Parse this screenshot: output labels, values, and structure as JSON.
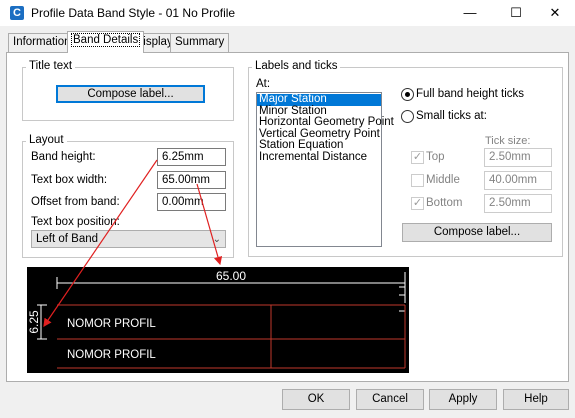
{
  "window": {
    "title": "Profile Data Band Style - 01 No Profile",
    "app_icon_letter": "C",
    "minimize": "—",
    "maximize": "☐",
    "close": "✕"
  },
  "tabs": [
    {
      "label": "Information"
    },
    {
      "label": "Band Details"
    },
    {
      "label": "Display"
    },
    {
      "label": "Summary"
    }
  ],
  "title_text": {
    "group_label": "Title text",
    "compose_button": "Compose label..."
  },
  "layout": {
    "group_label": "Layout",
    "band_height_label": "Band height:",
    "band_height_value": "6.25mm",
    "text_box_width_label": "Text box width:",
    "text_box_width_value": "65.00mm",
    "offset_label": "Offset from band:",
    "offset_value": "0.00mm",
    "position_label": "Text box position:",
    "position_value": "Left of Band"
  },
  "labels_ticks": {
    "group_label": "Labels and ticks",
    "at_label": "At:",
    "items": [
      "Major Station",
      "Minor Station",
      "Horizontal Geometry Point",
      "Vertical Geometry Point",
      "Station Equation",
      "Incremental Distance"
    ],
    "full_band_label": "Full band height ticks",
    "small_ticks_label": "Small ticks at:",
    "tick_size_label": "Tick size:",
    "top_label": "Top",
    "top_value": "2.50mm",
    "middle_label": "Middle",
    "middle_value": "40.00mm",
    "bottom_label": "Bottom",
    "bottom_value": "2.50mm",
    "compose_button": "Compose label..."
  },
  "preview": {
    "width_annotation": "65.00",
    "height_annotation": "6.25",
    "row1_text": "NOMOR PROFIL",
    "row2_text": "NOMOR PROFIL"
  },
  "buttons": {
    "ok": "OK",
    "cancel": "Cancel",
    "apply": "Apply",
    "help": "Help"
  },
  "colors": {
    "accent": "#0078d7",
    "arrow": "#e02020"
  }
}
